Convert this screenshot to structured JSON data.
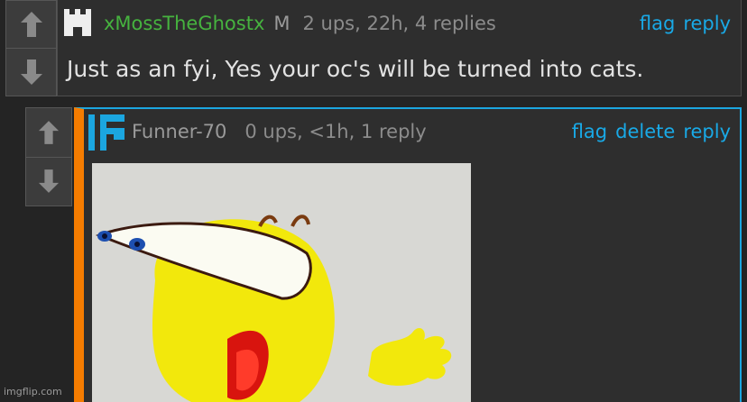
{
  "comments": [
    {
      "username": "xMossTheGhostx",
      "badge": "M",
      "stats": "2 ups, 22h, 4 replies",
      "actions": [
        "flag",
        "reply"
      ],
      "text": "Just as an fyi, Yes your oc's will be turned into cats."
    },
    {
      "username": "Funner-70",
      "stats": "0 ups, <1h, 1 reply",
      "actions": [
        "flag",
        "delete",
        "reply"
      ],
      "avatar_letter": "F"
    }
  ],
  "watermark": "imgflip.com",
  "colors": {
    "background": "#242424",
    "panel": "#2e2e2e",
    "username_green": "#46b33f",
    "link_blue": "#19a9e6",
    "reply_border_orange": "#f57c00",
    "reply_border_blue": "#1ba6e0"
  },
  "icons": {
    "upvote": "up-arrow-icon",
    "downvote": "down-arrow-icon",
    "avatar1": "pixel-ghost-avatar-icon",
    "avatar2": "letter-f-avatar-icon"
  }
}
